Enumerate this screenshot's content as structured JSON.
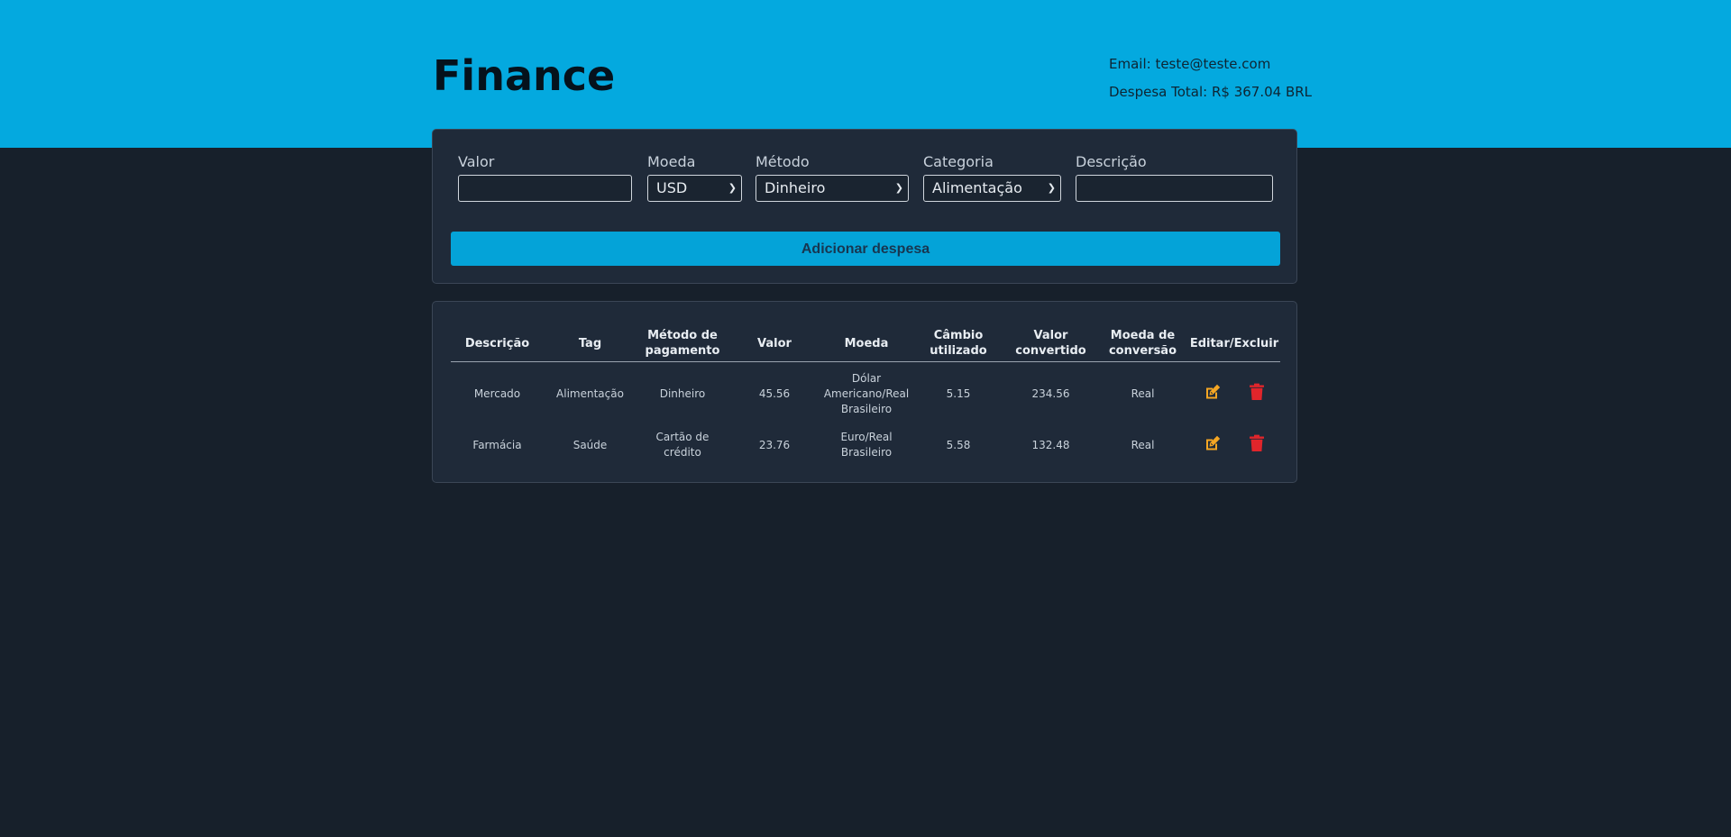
{
  "header": {
    "title": "Finance",
    "email": "Email: teste@teste.com",
    "total_expense": "Despesa Total: R$ 367.04 BRL",
    "background_color": "#04a9df"
  },
  "form": {
    "fields": {
      "value": {
        "label": "Valor",
        "value": ""
      },
      "currency": {
        "label": "Moeda",
        "selected": "USD"
      },
      "method": {
        "label": "Método",
        "selected": "Dinheiro"
      },
      "category": {
        "label": "Categoria",
        "selected": "Alimentação"
      },
      "description": {
        "label": "Descrição",
        "value": ""
      }
    },
    "submit_label": "Adicionar despesa",
    "accent_color": "#04a3d8"
  },
  "table": {
    "columns": [
      "Descrição",
      "Tag",
      "Método de pagamento",
      "Valor",
      "Moeda",
      "Câmbio utilizado",
      "Valor convertido",
      "Moeda de conversão",
      "Editar/Excluir"
    ],
    "rows": [
      {
        "description": "Mercado",
        "tag": "Alimentação",
        "method": "Dinheiro",
        "value": "45.56",
        "currency": "Dólar Americano/Real Brasileiro",
        "exchange_rate": "5.15",
        "converted_value": "234.56",
        "conversion_currency": "Real",
        "edit_icon": "edit-icon",
        "delete_icon": "trash-icon"
      },
      {
        "description": "Farmácia",
        "tag": "Saúde",
        "method": "Cartão de crédito",
        "value": "23.76",
        "currency": "Euro/Real Brasileiro",
        "exchange_rate": "5.58",
        "converted_value": "132.48",
        "conversion_currency": "Real",
        "edit_icon": "edit-icon",
        "delete_icon": "trash-icon"
      }
    ],
    "edit_icon_color": "#f5a623",
    "delete_icon_color": "#e0252b"
  }
}
